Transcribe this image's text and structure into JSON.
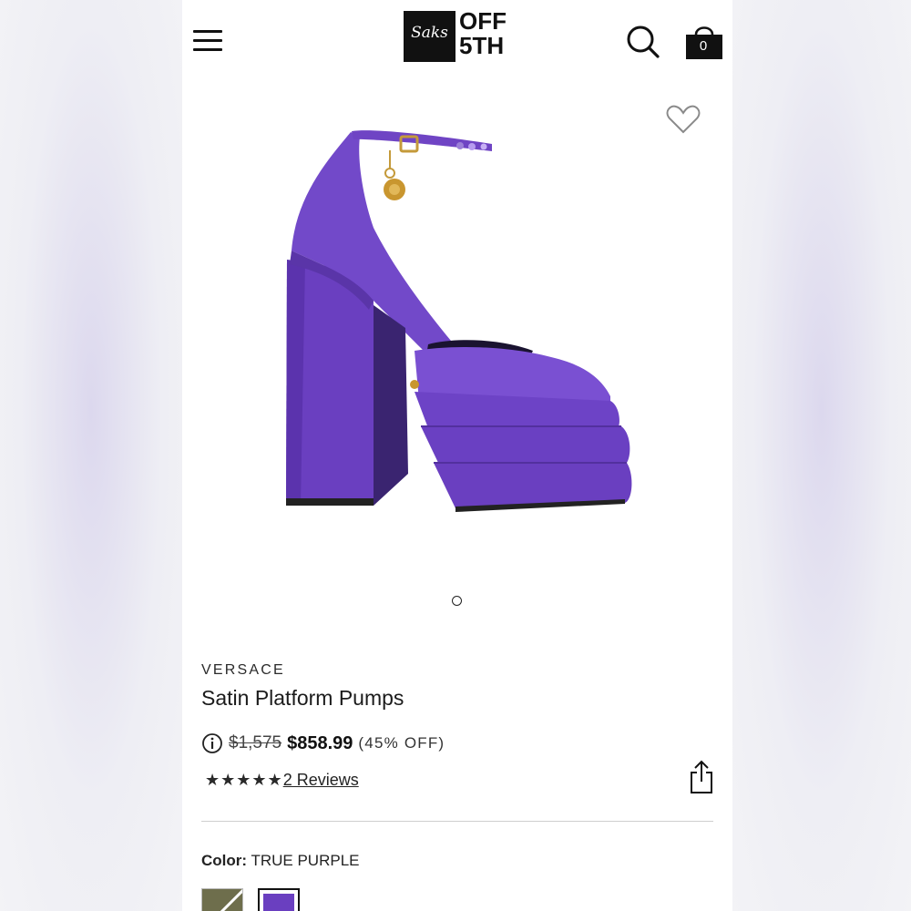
{
  "header": {
    "logo_script": "Saks",
    "logo_line1": "OFF",
    "logo_line2": "5TH",
    "bag_count": "0",
    "icons": [
      "menu-icon",
      "search-icon",
      "shopping-bag-icon",
      "heart-icon"
    ]
  },
  "product": {
    "brand": "VERSACE",
    "title": "Satin Platform Pumps",
    "original_price": "$1,575",
    "sale_price": "$858.99",
    "discount": "(45% OFF)",
    "stars": "★★★★★",
    "rating_out_of_5": 5,
    "reviews_label": "2 Reviews",
    "color_label": "Color:",
    "color_value": "TRUE PURPLE",
    "image_dots": 1
  },
  "colors": {
    "shoe_purple": "#6f44c4",
    "swatch_green": "#6e6e4c",
    "swatch_purple": "#6a3fc0"
  }
}
